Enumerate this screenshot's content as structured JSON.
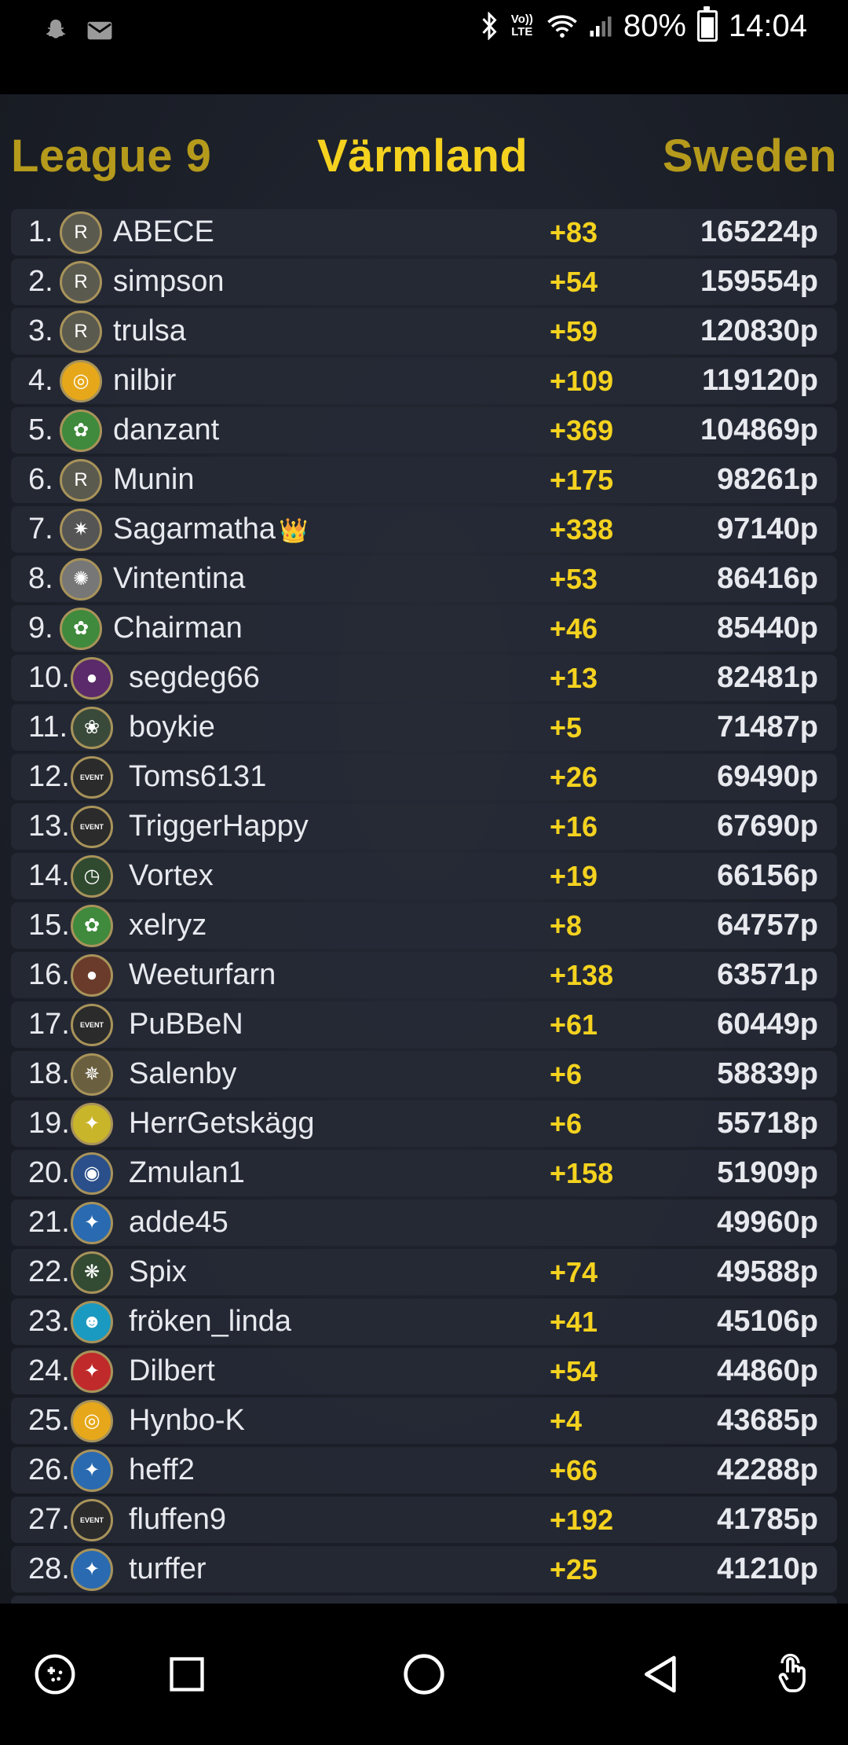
{
  "status_bar": {
    "notification_icons": [
      "snapchat-icon",
      "mail-icon"
    ],
    "system_icons": [
      "bluetooth-icon",
      "volte-icon",
      "wifi-icon",
      "signal-icon"
    ],
    "volte_label": "Vo)) LTE",
    "battery_percent": "80%",
    "time": "14:04"
  },
  "header": {
    "league": "League 9",
    "region": "Värmland",
    "country": "Sweden"
  },
  "colors": {
    "gold": "#b59a1c",
    "yellow": "#f4d21f",
    "row_bg": "#262a36"
  },
  "leaderboard": [
    {
      "rank": "1.",
      "name": "ABECE",
      "delta": "+83",
      "points": "165224p",
      "avatar": "r-badge-icon",
      "avatar_glyph": "R",
      "avatar_color": "#5b5a4f"
    },
    {
      "rank": "2.",
      "name": "simpson",
      "delta": "+54",
      "points": "159554p",
      "avatar": "r-badge-icon",
      "avatar_glyph": "R",
      "avatar_color": "#5b5a4f"
    },
    {
      "rank": "3.",
      "name": "trulsa",
      "delta": "+59",
      "points": "120830p",
      "avatar": "r-badge-icon",
      "avatar_glyph": "R",
      "avatar_color": "#5b5a4f"
    },
    {
      "rank": "4.",
      "name": "nilbir",
      "delta": "+109",
      "points": "119120p",
      "avatar": "target-badge-icon",
      "avatar_glyph": "◎",
      "avatar_color": "#e6a81a"
    },
    {
      "rank": "5.",
      "name": "danzant",
      "delta": "+369",
      "points": "104869p",
      "avatar": "green-badge-icon",
      "avatar_glyph": "✿",
      "avatar_color": "#3f8a3c"
    },
    {
      "rank": "6.",
      "name": "Munin",
      "delta": "+175",
      "points": "98261p",
      "avatar": "r-badge-icon",
      "avatar_glyph": "R",
      "avatar_color": "#5b5a4f"
    },
    {
      "rank": "7.",
      "name": "Sagarmatha",
      "delta": "+338",
      "points": "97140p",
      "avatar": "star-badge-icon",
      "avatar_glyph": "✷",
      "avatar_color": "#555",
      "crown": "👑"
    },
    {
      "rank": "8.",
      "name": "Vintentina",
      "delta": "+53",
      "points": "86416p",
      "avatar": "lion-badge-icon",
      "avatar_glyph": "✺",
      "avatar_color": "#777"
    },
    {
      "rank": "9.",
      "name": "Chairman",
      "delta": "+46",
      "points": "85440p",
      "avatar": "green-badge-icon",
      "avatar_glyph": "✿",
      "avatar_color": "#3f8a3c"
    },
    {
      "rank": "10.",
      "name": "segdeg66",
      "delta": "+13",
      "points": "82481p",
      "avatar": "hooded-figure-icon",
      "avatar_glyph": "●",
      "avatar_color": "#5a2a6a"
    },
    {
      "rank": "11.",
      "name": "boykie",
      "delta": "+5",
      "points": "71487p",
      "avatar": "flower-badge-icon",
      "avatar_glyph": "❀",
      "avatar_color": "#3a4a3a"
    },
    {
      "rank": "12.",
      "name": "Toms6131",
      "delta": "+26",
      "points": "69490p",
      "avatar": "event-badge-icon",
      "avatar_glyph": "EVENT",
      "avatar_color": "#2b2b2b"
    },
    {
      "rank": "13.",
      "name": "TriggerHappy",
      "delta": "+16",
      "points": "67690p",
      "avatar": "event-badge-icon",
      "avatar_glyph": "EVENT",
      "avatar_color": "#2b2b2b"
    },
    {
      "rank": "14.",
      "name": "Vortex",
      "delta": "+19",
      "points": "66156p",
      "avatar": "clock-badge-icon",
      "avatar_glyph": "◷",
      "avatar_color": "#2f4a2f"
    },
    {
      "rank": "15.",
      "name": "xelryz",
      "delta": "+8",
      "points": "64757p",
      "avatar": "green-badge-icon",
      "avatar_glyph": "✿",
      "avatar_color": "#3f8a3c"
    },
    {
      "rank": "16.",
      "name": "Weeturfarn",
      "delta": "+138",
      "points": "63571p",
      "avatar": "hooded-figure-icon",
      "avatar_glyph": "●",
      "avatar_color": "#6a3a2a"
    },
    {
      "rank": "17.",
      "name": "PuBBeN",
      "delta": "+61",
      "points": "60449p",
      "avatar": "event-badge-icon",
      "avatar_glyph": "EVENT",
      "avatar_color": "#2b2b2b"
    },
    {
      "rank": "18.",
      "name": "Salenby",
      "delta": "+6",
      "points": "58839p",
      "avatar": "gear-badge-icon",
      "avatar_glyph": "✵",
      "avatar_color": "#6a6040"
    },
    {
      "rank": "19.",
      "name": "HerrGetskägg",
      "delta": "+6",
      "points": "55718p",
      "avatar": "figure-badge-icon",
      "avatar_glyph": "✦",
      "avatar_color": "#c9b52a"
    },
    {
      "rank": "20.",
      "name": "Zmulan1",
      "delta": "+158",
      "points": "51909p",
      "avatar": "planet-badge-icon",
      "avatar_glyph": "◉",
      "avatar_color": "#2a4f8a"
    },
    {
      "rank": "21.",
      "name": "adde45",
      "delta": "",
      "points": "49960p",
      "avatar": "blue-figure-icon",
      "avatar_glyph": "✦",
      "avatar_color": "#2a6ab0"
    },
    {
      "rank": "22.",
      "name": "Spix",
      "delta": "+74",
      "points": "49588p",
      "avatar": "rune-badge-icon",
      "avatar_glyph": "❋",
      "avatar_color": "#334a33"
    },
    {
      "rank": "23.",
      "name": "fröken_linda",
      "delta": "+41",
      "points": "45106p",
      "avatar": "mask-badge-icon",
      "avatar_glyph": "☻",
      "avatar_color": "#1a9ac0"
    },
    {
      "rank": "24.",
      "name": "Dilbert",
      "delta": "+54",
      "points": "44860p",
      "avatar": "red-figure-icon",
      "avatar_glyph": "✦",
      "avatar_color": "#c02a2a"
    },
    {
      "rank": "25.",
      "name": "Hynbo-K",
      "delta": "+4",
      "points": "43685p",
      "avatar": "target-badge-icon",
      "avatar_glyph": "◎",
      "avatar_color": "#e6a81a"
    },
    {
      "rank": "26.",
      "name": "heff2",
      "delta": "+66",
      "points": "42288p",
      "avatar": "blue-figure-icon",
      "avatar_glyph": "✦",
      "avatar_color": "#2a6ab0"
    },
    {
      "rank": "27.",
      "name": "fluffen9",
      "delta": "+192",
      "points": "41785p",
      "avatar": "event-badge-icon",
      "avatar_glyph": "EVENT",
      "avatar_color": "#2b2b2b"
    },
    {
      "rank": "28.",
      "name": "turffer",
      "delta": "+25",
      "points": "41210p",
      "avatar": "blue-figure-icon",
      "avatar_glyph": "✦",
      "avatar_color": "#2a6ab0"
    }
  ],
  "nav_bar": {
    "buttons": [
      "game-tools-icon",
      "recents-icon",
      "home-icon",
      "back-icon",
      "touch-gesture-icon"
    ]
  }
}
